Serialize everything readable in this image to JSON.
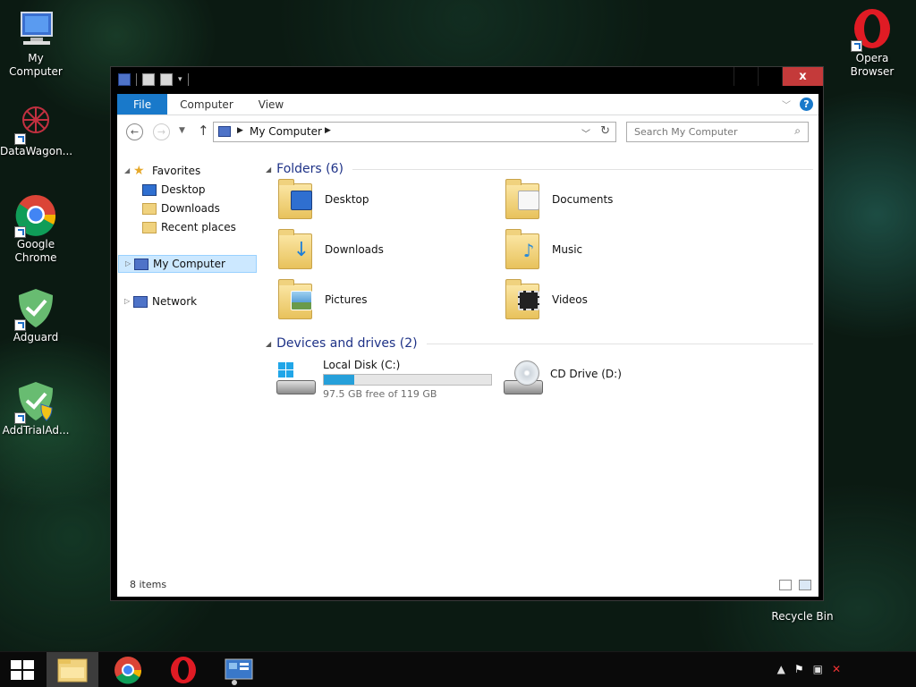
{
  "desktop": {
    "icons": [
      {
        "label": "My Computer"
      },
      {
        "label": "DataWagon..."
      },
      {
        "label": "Google\nChrome"
      },
      {
        "label": "Adguard"
      },
      {
        "label": "AddTrialAd..."
      },
      {
        "label": "Opera\nBrowser"
      },
      {
        "label": "Recycle Bin"
      }
    ]
  },
  "ribbon": {
    "tabs": [
      {
        "label": "File"
      },
      {
        "label": "Computer"
      },
      {
        "label": "View"
      }
    ],
    "help": "?"
  },
  "address": {
    "path": "My Computer",
    "search_placeholder": "Search My Computer"
  },
  "navpane": {
    "favorites": "Favorites",
    "desktop": "Desktop",
    "downloads": "Downloads",
    "recent": "Recent places",
    "my_computer": "My Computer",
    "network": "Network"
  },
  "content": {
    "folders_header": "Folders (6)",
    "folders": [
      {
        "name": "Desktop",
        "icon": "desktop-folder-icon"
      },
      {
        "name": "Documents",
        "icon": "documents-folder-icon"
      },
      {
        "name": "Downloads",
        "icon": "downloads-folder-icon"
      },
      {
        "name": "Music",
        "icon": "music-folder-icon"
      },
      {
        "name": "Pictures",
        "icon": "pictures-folder-icon"
      },
      {
        "name": "Videos",
        "icon": "videos-folder-icon"
      }
    ],
    "drives_header": "Devices and drives (2)",
    "drives": [
      {
        "name": "Local Disk (C:)",
        "free_text": "97.5 GB free of 119 GB",
        "used_fraction": 0.18
      },
      {
        "name": "CD Drive (D:)"
      }
    ]
  },
  "status": {
    "items": "8 items"
  },
  "window": {
    "close": "x"
  },
  "colors": {
    "file_tab": "#1979ca",
    "folders_header": "#1e3287",
    "progress": "#26a0da",
    "close": "#c43a3a"
  }
}
